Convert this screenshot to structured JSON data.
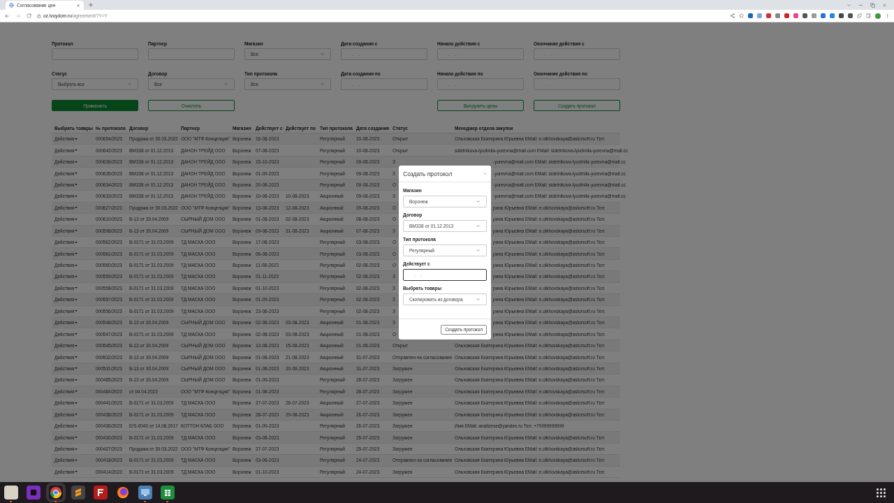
{
  "browser": {
    "tab_title": "Согласование цен",
    "url_domain": "oz.tvoydom.ru",
    "url_path": "/agreement/?Y=Y"
  },
  "filters": [
    {
      "label": "Протокол",
      "kind": "text"
    },
    {
      "label": "Партнер",
      "kind": "text"
    },
    {
      "label": "Магазин",
      "kind": "select",
      "value": "Все"
    },
    {
      "label": "Дата создания с",
      "kind": "date",
      "placeholder": "__.__.____"
    },
    {
      "label": "Начало действия с",
      "kind": "date",
      "placeholder": "__.__.____"
    },
    {
      "label": "Окончание действия с",
      "kind": "date",
      "placeholder": "__.__.____"
    },
    {
      "label": "Статус",
      "kind": "select",
      "value": "Выбрать все"
    },
    {
      "label": "Договор",
      "kind": "select",
      "value": "Все"
    },
    {
      "label": "Тип протокола",
      "kind": "select",
      "value": "Все"
    },
    {
      "label": "Дата создания по",
      "kind": "date",
      "placeholder": "__.__.____"
    },
    {
      "label": "Начало действия по",
      "kind": "date",
      "placeholder": "__.__.____"
    },
    {
      "label": "Окончание действия по",
      "kind": "date",
      "placeholder": "__.__.____"
    }
  ],
  "left_buttons": [
    {
      "label": "Применить",
      "kind": "primary"
    },
    {
      "label": "Очистить",
      "kind": "outline"
    }
  ],
  "right_buttons": [
    {
      "label": "Выгрузить цены"
    },
    {
      "label": "Создать протокол"
    }
  ],
  "table": {
    "columns": [
      "Выбрать товары",
      "№ протокола",
      "Договор",
      "Партнер",
      "Магазин",
      "Действует с",
      "Действует по",
      "Тип протокола",
      "Дата создания",
      "Статус",
      "Менеджер отдела закупок"
    ],
    "rows": [
      {
        "kind": "plain",
        "action": "Действия",
        "number": "000654/2023",
        "contract": "Продажа от 30.03.2022",
        "partner": "ООО \"МТФ Концепция\"",
        "store": "Воронеж",
        "valid_from": "16-08-2023",
        "type": "Регулярный",
        "created": "10-08-2023",
        "status": "Открыт",
        "manager": "Ольховская Екатерина Юрьевна EMail: e.olkhovskaya@astorsoft.ru Тел:"
      },
      {
        "kind": "plain",
        "action": "Действия",
        "number": "000642/2023",
        "contract": "ВМ338 от 01.12.2013",
        "partner": "ДАНОН ТРЕЙД ООО",
        "store": "Воронеж",
        "valid_from": "07-08-2023",
        "type": "Регулярный",
        "created": "10-08-2023",
        "status": "Открыт",
        "manager": "sidelnikova-lyudmila-yurevna@mail.com EMail: sidelnikova-lyudmila-yurevna@mail.cc"
      },
      {
        "kind": "under_dialog",
        "action": "Действия",
        "number": "000636/2023",
        "contract": "ВМ338 от 01.12.2013",
        "partner": "ДАНОН ТРЕЙД ООО",
        "store": "Воронеж",
        "valid_from": "15-10-2023",
        "type": "Регулярный",
        "created": "09-08-2023",
        "status": "З",
        "manager": "-yurevna@mail.com EMail: sidelnikova-lyudmila-yurevna@mail.cc"
      },
      {
        "kind": "under_dialog",
        "action": "Действия",
        "number": "000635/2023",
        "contract": "ВМ338 от 01.12.2013",
        "partner": "ДАНОН ТРЕЙД ООО",
        "store": "Воронеж",
        "valid_from": "01-09-2023",
        "type": "Регулярный",
        "created": "09-08-2023",
        "status": "З",
        "manager": "-yurevna@mail.com EMail: sidelnikova-lyudmila-yurevna@mail.cc"
      },
      {
        "kind": "under_dialog",
        "action": "Действия",
        "number": "000634/2023",
        "contract": "ВМ338 от 01.12.2013",
        "partner": "ДАНОН ТРЕЙД ООО",
        "store": "Воронеж",
        "valid_from": "20-08-2023",
        "type": "Регулярный",
        "created": "09-08-2023",
        "status": "О",
        "manager": "-yurevna@mail.com EMail: sidelnikova-lyudmila-yurevna@mail.cc"
      },
      {
        "kind": "under_dialog",
        "action": "Действия",
        "number": "000633/2023",
        "contract": "ВМ338 от 01.12.2013",
        "partner": "ДАНОН ТРЕЙД ООО",
        "store": "Воронеж",
        "valid_from": "10-08-2023",
        "valid_to": "10-08-2023",
        "type": "Акционный",
        "created": "09-08-2023",
        "status": "З",
        "manager": "-yurevna@mail.com EMail: sidelnikova-lyudmila-yurevna@mail.cc"
      },
      {
        "kind": "under_dialog",
        "action": "Действия",
        "number": "000627/2023",
        "contract": "Продажа от 30.03.2022",
        "partner": "ООО \"МТФ Концепция\"",
        "store": "Воронеж",
        "valid_from": "13-08-2023",
        "valid_to": "12-08-2023",
        "type": "Акционный",
        "created": "09-08-2023",
        "status": "О",
        "manager": "рина Юрьевна EMail: e.olkhovskaya@astorsoft.ru Тел:"
      },
      {
        "kind": "under_dialog",
        "action": "Действия",
        "number": "000610/2023",
        "contract": "В-13 от 30.04.2009",
        "partner": "СЫРНЫЙ ДОМ ООО",
        "store": "Воронеж",
        "valid_from": "01-08-2023",
        "valid_to": "02-08-2023",
        "type": "Акционный",
        "created": "08-08-2023",
        "status": "О",
        "manager": "рина Юрьевна EMail: e.olkhovskaya@astorsoft.ru Тел:"
      },
      {
        "kind": "under_dialog",
        "action": "Действия",
        "number": "000598/2023",
        "contract": "В-13 от 30.04.2009",
        "partner": "СЫРНЫЙ ДОМ ООО",
        "store": "Воронеж",
        "valid_from": "09-08-2023",
        "valid_to": "31-08-2023",
        "type": "Акционный",
        "created": "07-08-2023",
        "status": "З",
        "manager": "рина Юрьевна EMail: e.olkhovskaya@astorsoft.ru Тел:"
      },
      {
        "kind": "under_dialog",
        "action": "Действия",
        "number": "000562/2023",
        "contract": "В-0171 от 31.03.2009",
        "partner": "ТД МАСКА ООО",
        "store": "Воронеж",
        "valid_from": "17-08-2023",
        "type": "Регулярный",
        "created": "03-08-2023",
        "status": "О",
        "manager": "рина Юрьевна EMail: e.olkhovskaya@astorsoft.ru Тел:"
      },
      {
        "kind": "under_dialog",
        "action": "Действия",
        "number": "000561/2023",
        "contract": "В-0171 от 31.03.2009",
        "partner": "ТД МАСКА ООО",
        "store": "Воронеж",
        "valid_from": "06-08-2023",
        "type": "Регулярный",
        "created": "03-08-2023",
        "status": "О",
        "manager": "рина Юрьевна EMail: e.olkhovskaya@astorsoft.ru Тел:"
      },
      {
        "kind": "under_dialog",
        "action": "Действия",
        "number": "000560/2023",
        "contract": "В-0171 от 31.03.2009",
        "partner": "ТД МАСКА ООО",
        "store": "Воронеж",
        "valid_from": "11-08-2023",
        "type": "Регулярный",
        "created": "02-08-2023",
        "status": "О",
        "manager": "рина Юрьевна EMail: e.olkhovskaya@astorsoft.ru Тел:"
      },
      {
        "kind": "under_dialog",
        "action": "Действия",
        "number": "000559/2023",
        "contract": "В-0171 от 31.03.2009",
        "partner": "ТД МАСКА ООО",
        "store": "Воронеж",
        "valid_from": "01-11-2023",
        "type": "Регулярный",
        "created": "02-08-2023",
        "status": "З",
        "manager": "рина Юрьевна EMail: e.olkhovskaya@astorsoft.ru Тел:"
      },
      {
        "kind": "under_dialog",
        "action": "Действия",
        "number": "000558/2023",
        "contract": "В-0171 от 31.03.2009",
        "partner": "ТД МАСКА ООО",
        "store": "Воронеж",
        "valid_from": "01-10-2023",
        "type": "Регулярный",
        "created": "02-08-2023",
        "status": "З",
        "manager": "рина Юрьевна EMail: e.olkhovskaya@astorsoft.ru Тел:"
      },
      {
        "kind": "under_dialog",
        "action": "Действия",
        "number": "000557/2023",
        "contract": "В-0171 от 31.03.2009",
        "partner": "ТД МАСКА ООО",
        "store": "Воронеж",
        "valid_from": "01-09-2023",
        "type": "Регулярный",
        "created": "02-08-2023",
        "status": "З",
        "manager": "рина Юрьевна EMail: e.olkhovskaya@astorsoft.ru Тел:"
      },
      {
        "kind": "under_dialog",
        "action": "Действия",
        "number": "000556/2023",
        "contract": "В-0171 от 31.03.2009",
        "partner": "ТД МАСКА ООО",
        "store": "Воронеж",
        "valid_from": "23-08-2023",
        "type": "Регулярный",
        "created": "02-08-2023",
        "status": "З",
        "manager": "рина Юрьевна EMail: e.olkhovskaya@astorsoft.ru Тел:"
      },
      {
        "kind": "under_dialog",
        "action": "Действия",
        "number": "000548/2023",
        "contract": "В-13 от 30.04.2009",
        "partner": "СЫРНЫЙ ДОМ ООО",
        "store": "Воронеж",
        "valid_from": "02-08-2023",
        "valid_to": "03-08-2023",
        "type": "Акционный",
        "created": "01-08-2023",
        "status": "З",
        "manager": "рина Юрьевна EMail: e.olkhovskaya@astorsoft.ru Тел:"
      },
      {
        "kind": "under_dialog",
        "action": "Действия",
        "number": "000547/2023",
        "contract": "В-0171 от 31.03.2009",
        "partner": "ТД МАСКА ООО",
        "store": "Воронеж",
        "valid_from": "02-08-2023",
        "valid_to": "03-08-2023",
        "type": "Акционный",
        "created": "01-08-2023",
        "status": "О",
        "manager": "рина Юрьевна EMail: e.olkhovskaya@astorsoft.ru Тел:"
      },
      {
        "kind": "plain",
        "action": "Действия",
        "number": "000545/2023",
        "contract": "В-13 от 30.04.2009",
        "partner": "СЫРНЫЙ ДОМ ООО",
        "store": "Воронеж",
        "valid_from": "13-08-2023",
        "valid_to": "15-08-2023",
        "type": "Акционный",
        "created": "01-08-2023",
        "status": "Открыт",
        "manager": "Ольховская Екатерина Юрьевна EMail: e.olkhovskaya@astorsoft.ru Тел:"
      },
      {
        "kind": "plain",
        "action": "Действия",
        "number": "000532/2023",
        "contract": "В-13 от 30.04.2009",
        "partner": "СЫРНЫЙ ДОМ ООО",
        "store": "Воронеж",
        "valid_from": "01-08-2023",
        "valid_to": "21-08-2023",
        "type": "Акционный",
        "created": "31-07-2023",
        "status": "Отправлен на согласование",
        "manager": "Ольховская Екатерина Юрьевна EMail: e.olkhovskaya@astorsoft.ru Тел:"
      },
      {
        "kind": "plain",
        "action": "Действия",
        "number": "000531/2023",
        "contract": "В-13 от 30.04.2009",
        "partner": "СЫРНЫЙ ДОМ ООО",
        "store": "Воронеж",
        "valid_from": "01-08-2023",
        "valid_to": "20-08-2023",
        "type": "Акционный",
        "created": "31-07-2023",
        "status": "Загружен",
        "manager": "Ольховская Екатерина Юрьевна EMail: e.olkhovskaya@astorsoft.ru Тел:"
      },
      {
        "kind": "plain",
        "action": "Действия",
        "number": "000485/2023",
        "contract": "В-13 от 30.04.2009",
        "partner": "СЫРНЫЙ ДОМ ООО",
        "store": "Воронеж",
        "valid_from": "01-09-2023",
        "type": "Регулярный",
        "created": "28-07-2023",
        "status": "Загружен",
        "manager": "Ольховская Екатерина Юрьевна EMail: e.olkhovskaya@astorsoft.ru Тел:"
      },
      {
        "kind": "plain",
        "action": "Действия",
        "number": "000484/2023",
        "contract": "от 04.04.2022",
        "partner": "ООО \"МТФ Концепция\"",
        "store": "Воронеж",
        "valid_from": "01-08-2023",
        "type": "Регулярный",
        "created": "28-07-2023",
        "status": "Загружен",
        "manager": "Ольховская Екатерина Юрьевна EMail: e.olkhovskaya@astorsoft.ru Тел:"
      },
      {
        "kind": "plain",
        "action": "Действия",
        "number": "000441/2023",
        "contract": "В-0171 от 31.03.2009",
        "partner": "ТД МАСКА ООО",
        "store": "Воронеж",
        "valid_from": "27-07-2023",
        "valid_to": "26-07-2023",
        "type": "Акционный",
        "created": "27-07-2023",
        "status": "Загружен",
        "manager": "Ольховская Екатерина Юрьевна EMail: e.olkhovskaya@astorsoft.ru Тел:"
      },
      {
        "kind": "plain",
        "action": "Действия",
        "number": "000438/2023",
        "contract": "В-0171 от 31.03.2009",
        "partner": "ТД МАСКА ООО",
        "store": "Воронеж",
        "valid_from": "28-07-2023",
        "valid_to": "29-08-2023",
        "type": "Акционный",
        "created": "26-07-2023",
        "status": "Загружен",
        "manager": "Ольховская Екатерина Юрьевна EMail: e.olkhovskaya@astorsoft.ru Тел:"
      },
      {
        "kind": "plain",
        "action": "Действия",
        "number": "000436/2023",
        "contract": "E/S-0040 от 14.08.2017",
        "partner": "КОТТОН КЛАБ ООО",
        "store": "Воронеж",
        "valid_from": "01-09-2023",
        "type": "Регулярный",
        "created": "26-07-2023",
        "status": "Загружен",
        "manager": "Имя EMail: analizese@yandex.ru Тел: +79999999999"
      },
      {
        "kind": "plain",
        "action": "Действия",
        "number": "000430/2023",
        "contract": "В-0171 от 31.03.2009",
        "partner": "ТД МАСКА ООО",
        "store": "Воронеж",
        "valid_from": "03-08-2023",
        "type": "Регулярный",
        "created": "25-07-2023",
        "status": "Загружен",
        "manager": "Ольховская Екатерина Юрьевна EMail: e.olkhovskaya@astorsoft.ru Тел:"
      },
      {
        "kind": "plain",
        "action": "Действия",
        "number": "000427/2023",
        "contract": "Продажа от 30.03.2022",
        "partner": "ООО \"МТФ Концепция\"",
        "store": "Воронеж",
        "valid_from": "27-07-2023",
        "type": "Регулярный",
        "created": "25-07-2023",
        "status": "Загружен",
        "manager": "Ольховская Екатерина Юрьевна EMail: e.olkhovskaya@astorsoft.ru Тел:"
      },
      {
        "kind": "plain",
        "action": "Действия",
        "number": "000418/2023",
        "contract": "В-0171 от 31.03.2009",
        "partner": "ТД МАСКА ООО",
        "store": "Воронеж",
        "valid_from": "03-08-2023",
        "type": "Регулярный",
        "created": "24-07-2023",
        "status": "Отправлен на согласование",
        "manager": "Ольховская Екатерина Юрьевна EMail: e.olkhovskaya@astorsoft.ru Тел:"
      },
      {
        "kind": "plain",
        "action": "Действия",
        "number": "000414/2023",
        "contract": "В-0171 от 31.03.2009",
        "partner": "ТД МАСКА ООО",
        "store": "Воронеж",
        "valid_from": "01-10-2023",
        "type": "Регулярный",
        "created": "24-07-2023",
        "status": "Загружен",
        "manager": "Ольховская Екатерина Юрьевна EMail: e.olkhovskaya@astorsoft.ru Тел:"
      }
    ]
  },
  "dialog": {
    "title": "Создать протокол",
    "close": "×",
    "fields": [
      {
        "label": "Магазин",
        "kind": "select",
        "value": "Воронеж"
      },
      {
        "label": "Договор",
        "kind": "select",
        "value": "ВМ338 от 01.12.2013"
      },
      {
        "label": "Тип протокола",
        "kind": "select",
        "value": "Регулярный"
      },
      {
        "label": "Действует с",
        "kind": "date",
        "placeholder": "__.__.____",
        "focused": true
      },
      {
        "label": "Выбрать товары",
        "kind": "select",
        "value": "Скопировать из договора"
      }
    ],
    "submit": "Создать протокол"
  }
}
